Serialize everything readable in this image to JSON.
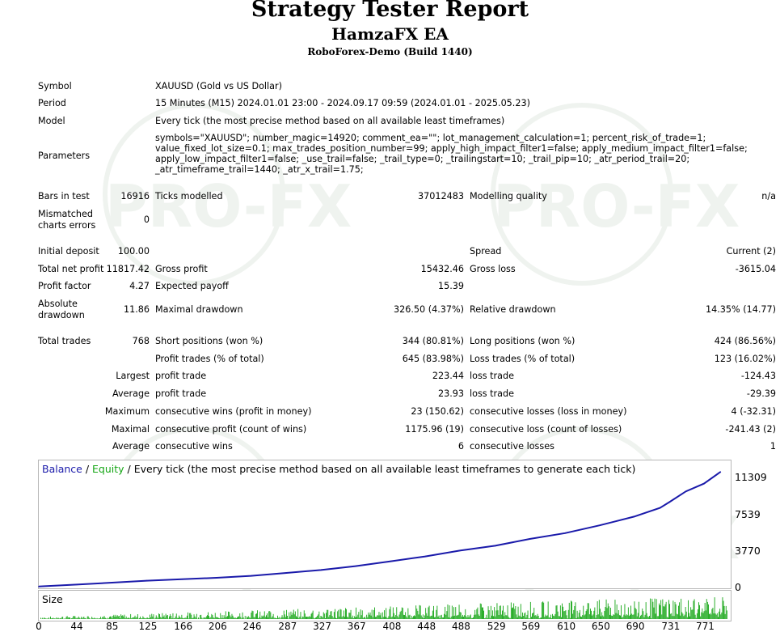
{
  "header": {
    "title": "Strategy Tester Report",
    "ea_name": "HamzaFX EA",
    "server": "RoboForex-Demo (Build 1440)"
  },
  "info": {
    "symbol_label": "Symbol",
    "symbol_value": "XAUUSD (Gold vs US Dollar)",
    "period_label": "Period",
    "period_value": "15 Minutes (M15) 2024.01.01 23:00 - 2024.09.17 09:59 (2024.01.01 - 2025.05.23)",
    "model_label": "Model",
    "model_value": "Every tick (the most precise method based on all available least timeframes)",
    "parameters_label": "Parameters",
    "parameters_lines": [
      "symbols=\"XAUUSD\"; number_magic=14920; comment_ea=\"\"; lot_management_calculation=1; percent_risk_of_trade=1;",
      "value_fixed_lot_size=0.1; max_trades_position_number=99; apply_high_impact_filter1=false; apply_medium_impact_filter1=false;",
      "apply_low_impact_filter1=false; _use_trail=false; _trail_type=0; _trailingstart=10; _trail_pip=10; _atr_period_trail=20;",
      "_atr_timeframe_trail=1440; _atr_x_trail=1.75;"
    ]
  },
  "stats": {
    "bars_label": "Bars in test",
    "bars_value": "16916",
    "ticks_label": "Ticks modelled",
    "ticks_value": "37012483",
    "quality_label": "Modelling quality",
    "quality_value": "n/a",
    "mismatch_label_1": "Mismatched",
    "mismatch_label_2": "charts errors",
    "mismatch_value": "0",
    "deposit_label": "Initial deposit",
    "deposit_value": "100.00",
    "spread_label": "Spread",
    "spread_value": "Current (2)",
    "net_label": "Total net profit",
    "net_value": "11817.42",
    "gross_profit_label": "Gross profit",
    "gross_profit_value": "15432.46",
    "gross_loss_label": "Gross loss",
    "gross_loss_value": "-3615.04",
    "pf_label": "Profit factor",
    "pf_value": "4.27",
    "payoff_label": "Expected payoff",
    "payoff_value": "15.39",
    "abs_dd_label_1": "Absolute",
    "abs_dd_label_2": "drawdown",
    "abs_dd_value": "11.86",
    "max_dd_label": "Maximal drawdown",
    "max_dd_value": "326.50 (4.37%)",
    "rel_dd_label": "Relative drawdown",
    "rel_dd_value": "14.35% (14.77)",
    "trades_label": "Total trades",
    "trades_value": "768",
    "short_label": "Short positions (won %)",
    "short_value": "344 (80.81%)",
    "long_label": "Long positions (won %)",
    "long_value": "424 (86.56%)",
    "ptrades_label": "Profit trades (% of total)",
    "ptrades_value": "645 (83.98%)",
    "ltrades_label": "Loss trades (% of total)",
    "ltrades_value": "123 (16.02%)",
    "largest": "Largest",
    "average": "Average",
    "maximum": "Maximum",
    "maximal": "Maximal",
    "profit_trade": "profit trade",
    "loss_trade": "loss trade",
    "largest_profit": "223.44",
    "largest_loss": "-124.43",
    "average_profit": "23.93",
    "average_loss": "-29.39",
    "cons_wins_money_label": "consecutive wins (profit in money)",
    "cons_wins_money_value": "23 (150.62)",
    "cons_losses_money_label": "consecutive losses (loss in money)",
    "cons_losses_money_value": "4 (-32.31)",
    "cons_profit_count_label": "consecutive profit (count of wins)",
    "cons_profit_count_value": "1175.96 (19)",
    "cons_loss_count_label": "consecutive loss (count of losses)",
    "cons_loss_count_value": "-241.43 (2)",
    "avg_cons_wins_label": "consecutive wins",
    "avg_cons_wins_value": "6",
    "avg_cons_losses_label": "consecutive losses",
    "avg_cons_losses_value": "1"
  },
  "chart_data": {
    "type": "line",
    "legend_balance": "Balance",
    "legend_sep": " / ",
    "legend_equity": "Equity",
    "legend_rest": " / Every tick (the most precise method based on all available least timeframes to generate each tick)",
    "size_label": "Size",
    "colors": {
      "balance": "#1a1aaa",
      "equity": "#16a616",
      "size": "#16a616"
    },
    "ylim": [
      0,
      13000
    ],
    "yticks": [
      "11309",
      "7539",
      "3770",
      "0"
    ],
    "ytick_values": [
      11309,
      7539,
      3770,
      0
    ],
    "xlim": [
      0,
      800
    ],
    "xticks": [
      "0",
      "44",
      "85",
      "125",
      "166",
      "206",
      "246",
      "287",
      "327",
      "367",
      "408",
      "448",
      "488",
      "529",
      "569",
      "610",
      "650",
      "690",
      "731",
      "771"
    ],
    "xtick_values": [
      0,
      44,
      85,
      125,
      166,
      206,
      246,
      287,
      327,
      367,
      408,
      448,
      488,
      529,
      569,
      610,
      650,
      690,
      731,
      771
    ],
    "series": [
      {
        "name": "Balance",
        "x": [
          0,
          44,
          85,
          125,
          166,
          206,
          246,
          287,
          327,
          367,
          408,
          448,
          488,
          529,
          569,
          610,
          650,
          690,
          720,
          731,
          750,
          771,
          790
        ],
        "y": [
          100,
          300,
          500,
          700,
          850,
          1000,
          1200,
          1500,
          1800,
          2200,
          2700,
          3200,
          3800,
          4300,
          5000,
          5600,
          6400,
          7300,
          8200,
          8800,
          9900,
          10700,
          11900
        ]
      }
    ]
  }
}
